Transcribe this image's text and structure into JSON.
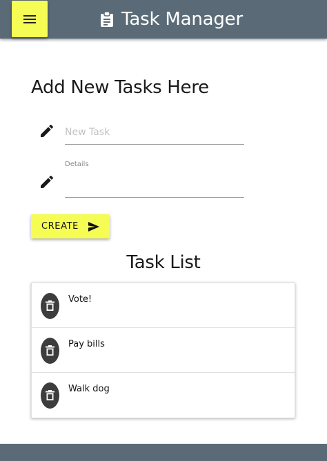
{
  "header": {
    "title": "Task Manager",
    "menu_icon": "hamburger-menu-icon",
    "brand_icon": "clipboard-icon",
    "background_color": "#5a6b77",
    "accent_color": "#f5fd54"
  },
  "form": {
    "title": "Add New Tasks Here",
    "new_task": {
      "placeholder": "New Task",
      "value": "",
      "icon": "pencil-icon"
    },
    "details": {
      "label": "Details",
      "value": "",
      "icon": "pencil-icon"
    },
    "create_button": {
      "label": "CREATE",
      "icon": "send-icon"
    }
  },
  "task_list": {
    "title": "Task List",
    "items": [
      {
        "text": "Vote!",
        "icon": "trash-icon"
      },
      {
        "text": "Pay bills",
        "icon": "trash-icon"
      },
      {
        "text": "Walk dog",
        "icon": "trash-icon"
      }
    ]
  }
}
